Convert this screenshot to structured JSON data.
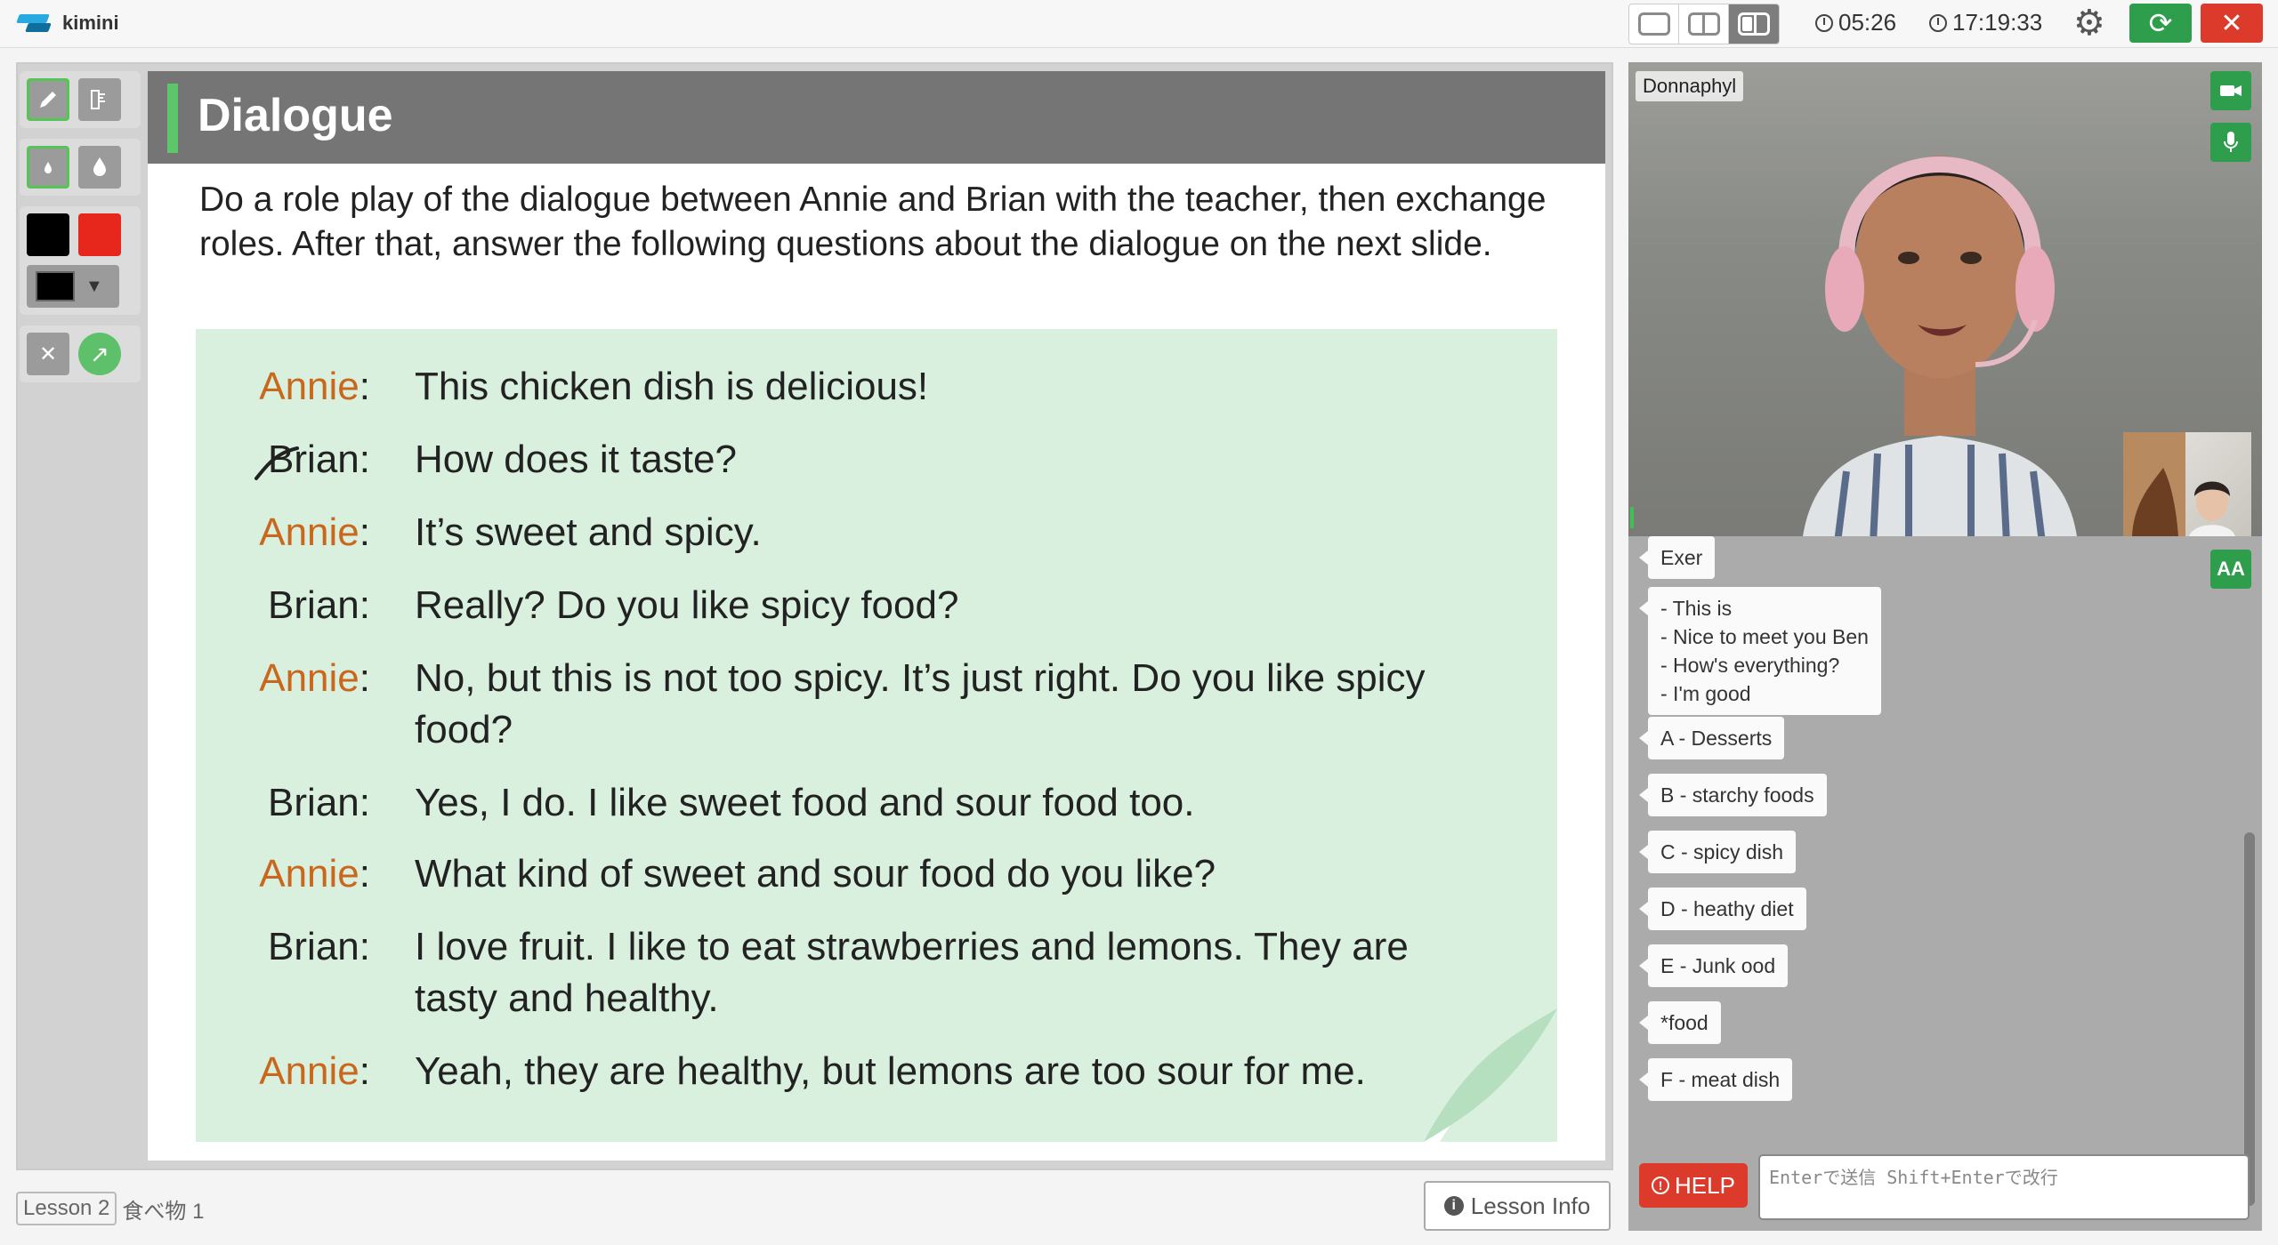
{
  "app": {
    "logo_text": "kimini"
  },
  "topbar": {
    "lesson_timer": "05:26",
    "clock": "17:19:33"
  },
  "slide": {
    "title": "Dialogue",
    "instructions": "Do a role play of the dialogue between Annie and Brian with the teacher, then exchange roles. After that, answer the following questions about the dialogue on the next slide.",
    "lines": [
      {
        "speaker": "Annie",
        "text": "This chicken dish is delicious!"
      },
      {
        "speaker": "Brian",
        "text": "How does it taste?"
      },
      {
        "speaker": "Annie",
        "text": "It’s sweet and spicy."
      },
      {
        "speaker": "Brian",
        "text": "Really? Do you like spicy food?"
      },
      {
        "speaker": "Annie",
        "text": "No, but this is not too spicy. It’s just right. Do you like spicy food?"
      },
      {
        "speaker": "Brian",
        "text": "Yes, I do. I like sweet food and sour food too."
      },
      {
        "speaker": "Annie",
        "text": "What kind of sweet and sour food do you like?"
      },
      {
        "speaker": "Brian",
        "text": "I love fruit. I like to eat strawberries and lemons. They are tasty and healthy."
      },
      {
        "speaker": "Annie",
        "text": "Yeah, they are healthy, but lemons are too sour for me."
      }
    ],
    "colon": ":"
  },
  "footer": {
    "lesson_tag": "Lesson 2",
    "lesson_name": "食べ物 1",
    "lesson_info_label": "Lesson Info"
  },
  "video": {
    "participant_name": "Donnaphyl"
  },
  "chat": {
    "messages": [
      "Exer",
      "- This is\n- Nice to meet you Ben\n- How's everything?\n- I'm good",
      "A - Desserts",
      "B - starchy foods",
      "C - spicy dish",
      "D - heathy diet",
      "E - Junk ood",
      "*food",
      "F - meat dish"
    ],
    "font_button": "AA",
    "help_label": "HELP",
    "input_placeholder": "Enterで送信 Shift+Enterで改行"
  },
  "colors": {
    "accent_green": "#2e9e4c",
    "danger_red": "#dc3b2c",
    "annie_orange": "#c9671d",
    "dialogue_bg": "#d9f0de",
    "header_gray": "#757575"
  },
  "icons": {
    "pen": "pen-icon",
    "ruler": "ruler-icon",
    "drop_small": "drop-small-icon",
    "drop_large": "drop-large-icon",
    "clear": "clear-icon",
    "arrow": "arrow-icon",
    "camera": "camera-icon",
    "mic": "mic-icon",
    "settings": "gear-icon",
    "refresh": "refresh-icon",
    "close": "close-icon"
  }
}
